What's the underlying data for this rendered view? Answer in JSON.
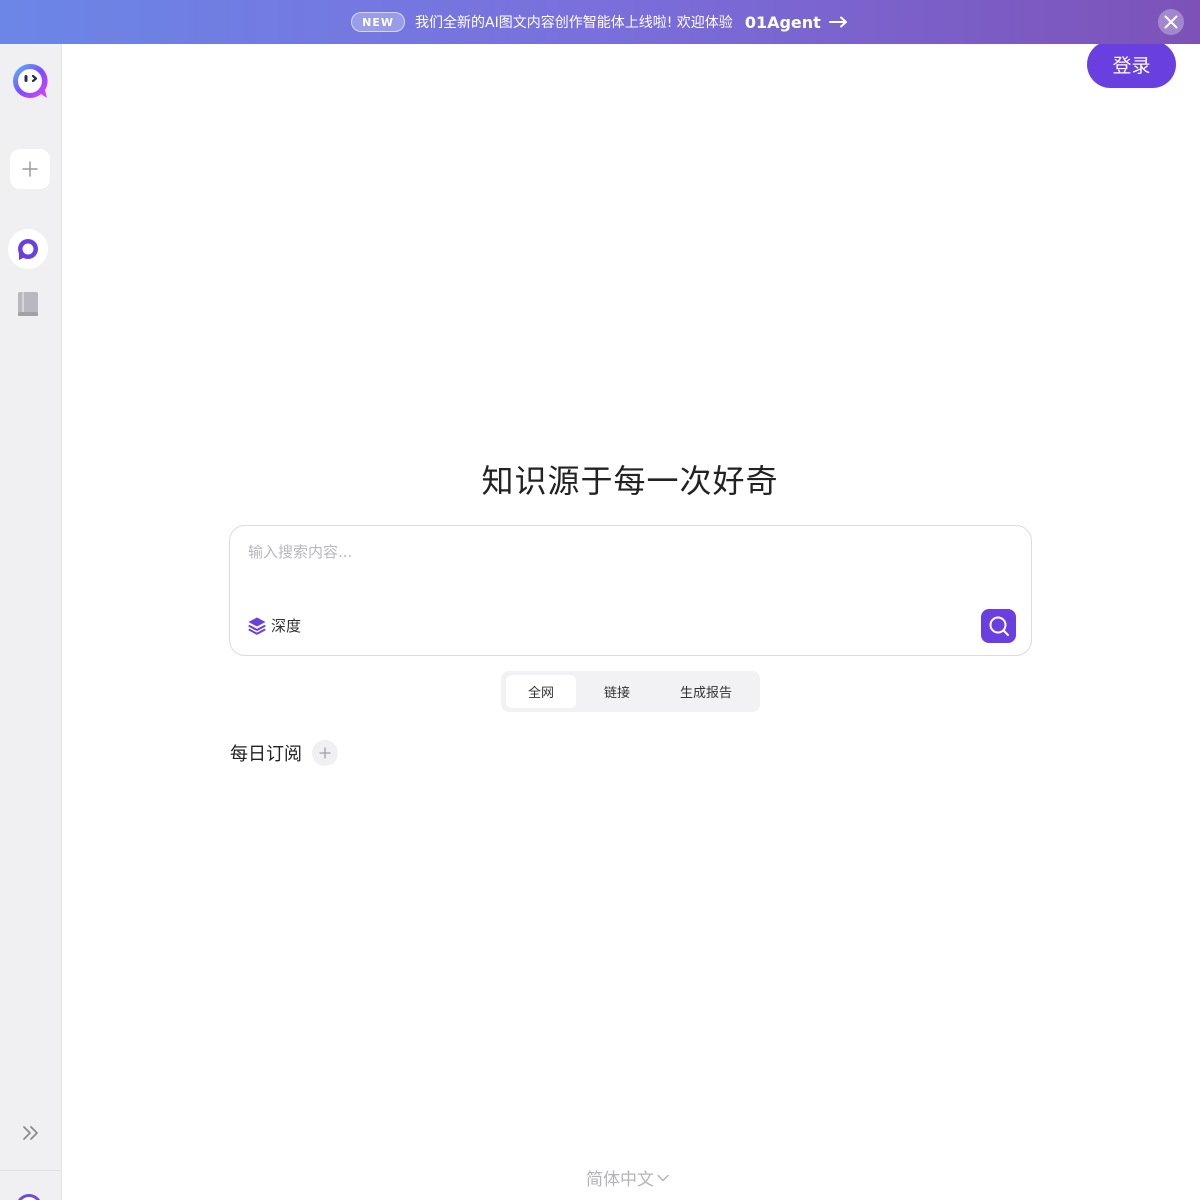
{
  "banner": {
    "badge": "NEW",
    "text": "我们全新的AI图文内容创作智能体上线啦! 欢迎体验",
    "link_label": "01Agent",
    "arrow_icon": "arrow-right-icon",
    "close_icon": "close-icon"
  },
  "sidebar": {
    "logo_icon": "chat-bubble-logo-icon",
    "new_chat_icon": "plus-icon",
    "items": [
      {
        "icon": "search-bubble-icon",
        "active": true
      },
      {
        "icon": "book-icon",
        "active": false
      }
    ],
    "expand_icon": "double-chevron-right-icon"
  },
  "header": {
    "login_label": "登录"
  },
  "main": {
    "title": "知识源于每一次好奇",
    "search": {
      "placeholder": "输入搜索内容...",
      "value": "",
      "depth_label": "深度",
      "depth_icon": "layers-icon",
      "submit_icon": "search-icon"
    },
    "tabs": [
      {
        "label": "全网",
        "active": true
      },
      {
        "label": "链接",
        "active": false
      },
      {
        "label": "生成报告",
        "active": false
      }
    ],
    "subscription": {
      "title": "每日订阅",
      "add_icon": "plus-icon"
    }
  },
  "footer": {
    "language": "简体中文",
    "language_icon": "chevron-down-icon"
  },
  "colors": {
    "accent": "#6a3fe0",
    "banner_start": "#6b86e6",
    "banner_end": "#7c52b8",
    "sidebar_bg": "#f0f0f2"
  }
}
